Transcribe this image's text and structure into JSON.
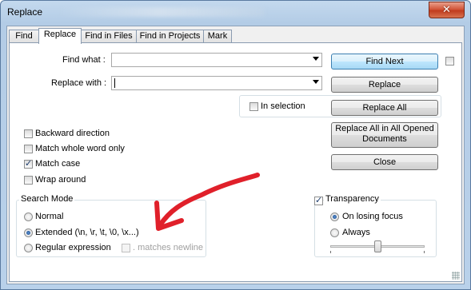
{
  "window": {
    "title": "Replace",
    "close_symbol": "✕"
  },
  "tabs": [
    {
      "label": "Find",
      "active": false
    },
    {
      "label": "Replace",
      "active": true
    },
    {
      "label": "Find in Files",
      "active": false
    },
    {
      "label": "Find in Projects",
      "active": false
    },
    {
      "label": "Mark",
      "active": false
    }
  ],
  "form": {
    "find_label": "Find what :",
    "find_value": "",
    "replace_label": "Replace with :",
    "replace_value": ""
  },
  "buttons": {
    "find_next": "Find Next",
    "replace": "Replace",
    "replace_all": "Replace All",
    "replace_all_docs": "Replace All in All Opened Documents",
    "close": "Close"
  },
  "in_selection": {
    "label": "In selection",
    "checked": false
  },
  "options": [
    {
      "label": "Backward direction",
      "checked": false
    },
    {
      "label": "Match whole word only",
      "checked": false
    },
    {
      "label": "Match case",
      "checked": true
    },
    {
      "label": "Wrap around",
      "checked": false
    }
  ],
  "search_mode": {
    "title": "Search Mode",
    "options": [
      {
        "label": "Normal",
        "selected": false
      },
      {
        "label": "Extended (\\n, \\r, \\t, \\0, \\x...)",
        "selected": true
      },
      {
        "label": "Regular expression",
        "selected": false
      }
    ],
    "matches_newline": {
      "label": ". matches newline",
      "enabled": false
    }
  },
  "transparency": {
    "label": "Transparency",
    "checked": true,
    "options": [
      {
        "label": "On losing focus",
        "selected": true
      },
      {
        "label": "Always",
        "selected": false
      }
    ],
    "slider_level": 0.5
  },
  "annotation": {
    "color": "#e0202a"
  },
  "colors": {
    "title_bg": "#b9d1ea",
    "close_button": "#c8472b",
    "default_button_border": "#3c7fb1"
  }
}
